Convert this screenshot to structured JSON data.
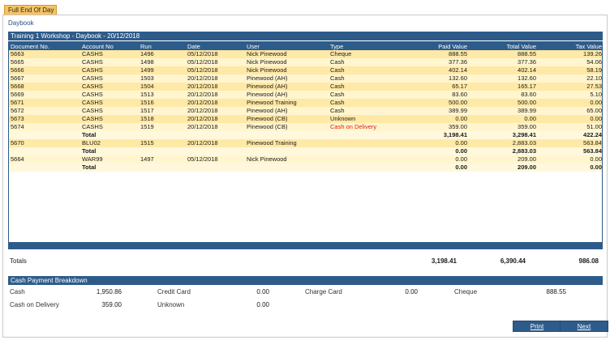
{
  "tab": {
    "label": "Full End Of Day"
  },
  "section_title": "Daybook",
  "grid": {
    "title": "Training 1 Workshop - Daybook - 20/12/2018",
    "columns": [
      "Document No.",
      "Account No",
      "Run",
      "Date",
      "User",
      "Type",
      "Paid Value",
      "Total Value",
      "Tax Value"
    ],
    "rows": [
      {
        "kind": "data",
        "doc": "5663",
        "account": "CASHS",
        "run": "1496",
        "date": "05/12/2018",
        "user": "Nick Pinewood",
        "type": "Cheque",
        "paid": "888.55",
        "total": "888.55",
        "tax": "139.26"
      },
      {
        "kind": "data",
        "doc": "5665",
        "account": "CASHS",
        "run": "1498",
        "date": "05/12/2018",
        "user": "Nick Pinewood",
        "type": "Cash",
        "paid": "377.36",
        "total": "377.36",
        "tax": "54.06"
      },
      {
        "kind": "data",
        "doc": "5666",
        "account": "CASHS",
        "run": "1499",
        "date": "05/12/2018",
        "user": "Nick Pinewood",
        "type": "Cash",
        "paid": "402.14",
        "total": "402.14",
        "tax": "58.19"
      },
      {
        "kind": "data",
        "doc": "5667",
        "account": "CASHS",
        "run": "1503",
        "date": "20/12/2018",
        "user": "Pinewood (AH)",
        "type": "Cash",
        "paid": "132.60",
        "total": "132.60",
        "tax": "22.10"
      },
      {
        "kind": "data",
        "doc": "5668",
        "account": "CASHS",
        "run": "1504",
        "date": "20/12/2018",
        "user": "Pinewood (AH)",
        "type": "Cash",
        "paid": "65.17",
        "total": "165.17",
        "tax": "27.53"
      },
      {
        "kind": "data",
        "doc": "5669",
        "account": "CASHS",
        "run": "1513",
        "date": "20/12/2018",
        "user": "Pinewood (AH)",
        "type": "Cash",
        "paid": "83.60",
        "total": "83.60",
        "tax": "5.10"
      },
      {
        "kind": "data",
        "doc": "5671",
        "account": "CASHS",
        "run": "1516",
        "date": "20/12/2018",
        "user": "Pinewood Training",
        "type": "Cash",
        "paid": "500.00",
        "total": "500.00",
        "tax": "0.00"
      },
      {
        "kind": "data",
        "doc": "5672",
        "account": "CASHS",
        "run": "1517",
        "date": "20/12/2018",
        "user": "Pinewood (AH)",
        "type": "Cash",
        "paid": "389.99",
        "total": "389.99",
        "tax": "65.00"
      },
      {
        "kind": "data",
        "doc": "5673",
        "account": "CASHS",
        "run": "1518",
        "date": "20/12/2018",
        "user": "Pinewood (CB)",
        "type": "Unknown",
        "paid": "0.00",
        "total": "0.00",
        "tax": "0.00"
      },
      {
        "kind": "data",
        "doc": "5674",
        "account": "CASHS",
        "run": "1519",
        "date": "20/12/2018",
        "user": "Pinewood (CB)",
        "type": "Cash on Delivery",
        "type_red": true,
        "paid": "359.00",
        "total": "359.00",
        "tax": "51.00"
      },
      {
        "kind": "total",
        "doc": "",
        "account": "Total",
        "run": "",
        "date": "",
        "user": "",
        "type": "",
        "paid": "3,198.41",
        "total": "3,298.41",
        "tax": "422.24"
      },
      {
        "kind": "data",
        "doc": "5670",
        "account": "BLU02",
        "run": "1515",
        "date": "20/12/2018",
        "user": "Pinewood Training",
        "type": "",
        "paid": "0.00",
        "total": "2,883.03",
        "tax": "563.84"
      },
      {
        "kind": "total",
        "doc": "",
        "account": "Total",
        "run": "",
        "date": "",
        "user": "",
        "type": "",
        "paid": "0.00",
        "total": "2,883.03",
        "tax": "563.84"
      },
      {
        "kind": "data",
        "doc": "5664",
        "account": "WAR99",
        "run": "1497",
        "date": "05/12/2018",
        "user": "Nick Pinewood",
        "type": "",
        "paid": "0.00",
        "total": "209.00",
        "tax": "0.00"
      },
      {
        "kind": "total",
        "doc": "",
        "account": "Total",
        "run": "",
        "date": "",
        "user": "",
        "type": "",
        "paid": "0.00",
        "total": "209.00",
        "tax": "0.00"
      }
    ]
  },
  "totals": {
    "label": "Totals",
    "paid": "3,198.41",
    "total": "6,390.44",
    "tax": "986.08"
  },
  "cash_breakdown": {
    "title": "Cash Payment Breakdown",
    "cash_label": "Cash",
    "cash_value": "1,950.86",
    "credit_card_label": "Credit Card",
    "credit_card_value": "0.00",
    "charge_card_label": "Charge Card",
    "charge_card_value": "0.00",
    "cheque_label": "Cheque",
    "cheque_value": "888.55",
    "cod_label": "Cash on Delivery",
    "cod_value": "359.00",
    "unknown_label": "Unknown",
    "unknown_value": "0.00"
  },
  "buttons": {
    "print": "Print",
    "next": "Next"
  },
  "colors": {
    "header_blue": "#2e5c8a",
    "row_odd": "#ffe9a6",
    "row_even": "#fff5cf",
    "tab_orange": "#f5c361",
    "alert_red": "#e0201b"
  }
}
